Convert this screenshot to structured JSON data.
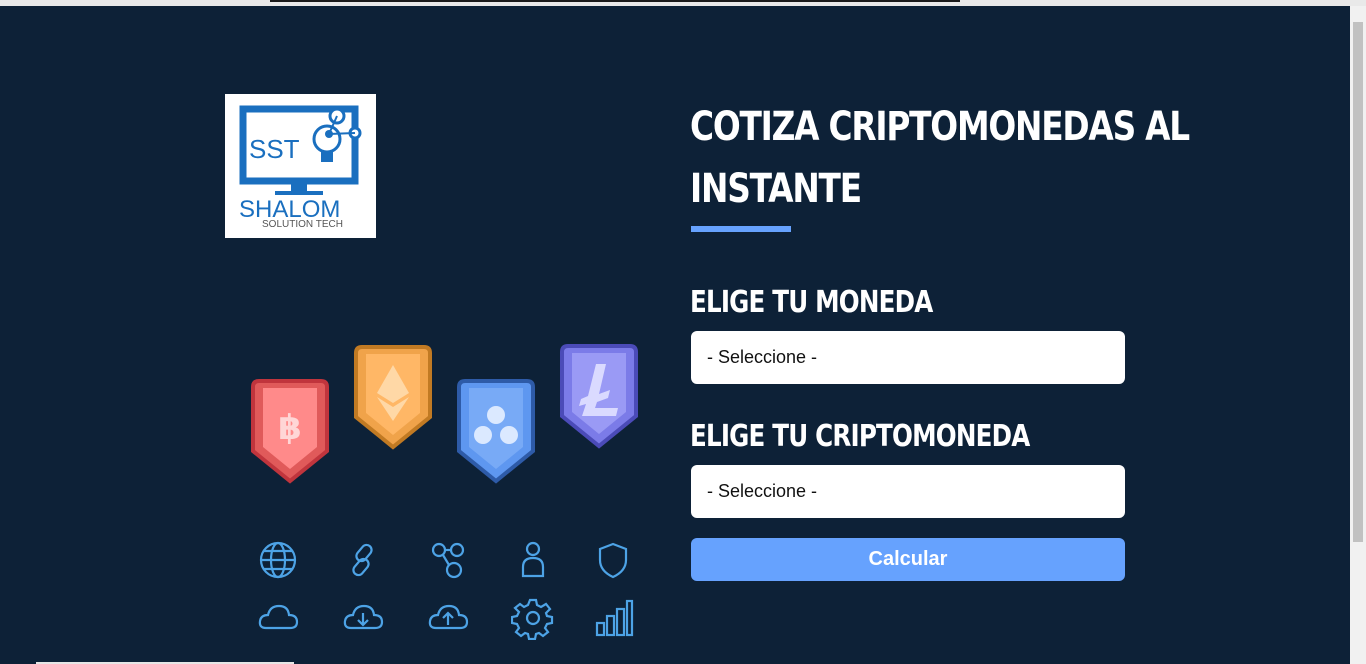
{
  "logo": {
    "initials": "SST",
    "brand": "SHALOM",
    "tagline": "SOLUTION TECH"
  },
  "coins": [
    {
      "name": "bitcoin",
      "icon": "bitcoin-icon",
      "color": "#e05a5a"
    },
    {
      "name": "ethereum",
      "icon": "ethereum-icon",
      "color": "#f0a34a"
    },
    {
      "name": "ripple",
      "icon": "ripple-icon",
      "color": "#5e97f0"
    },
    {
      "name": "litecoin",
      "icon": "litecoin-icon",
      "color": "#7b7be8"
    }
  ],
  "feature_icons": [
    "globe-icon",
    "link-icon",
    "network-icon",
    "user-icon",
    "shield-icon",
    "cloud-icon",
    "cloud-download-icon",
    "cloud-upload-icon",
    "gear-icon",
    "bar-chart-icon"
  ],
  "form": {
    "title": "Cotiza Criptomonedas al Instante",
    "currency_label": "Elige tu Moneda",
    "currency_value": "- Seleccione -",
    "crypto_label": "Elige tu Criptomoneda",
    "crypto_value": "- Seleccione -",
    "submit_label": "Calcular"
  },
  "colors": {
    "background": "#0d2137",
    "accent": "#66a2fe",
    "icon_stroke": "#4da3e6",
    "brand_blue": "#1a6fbf"
  }
}
